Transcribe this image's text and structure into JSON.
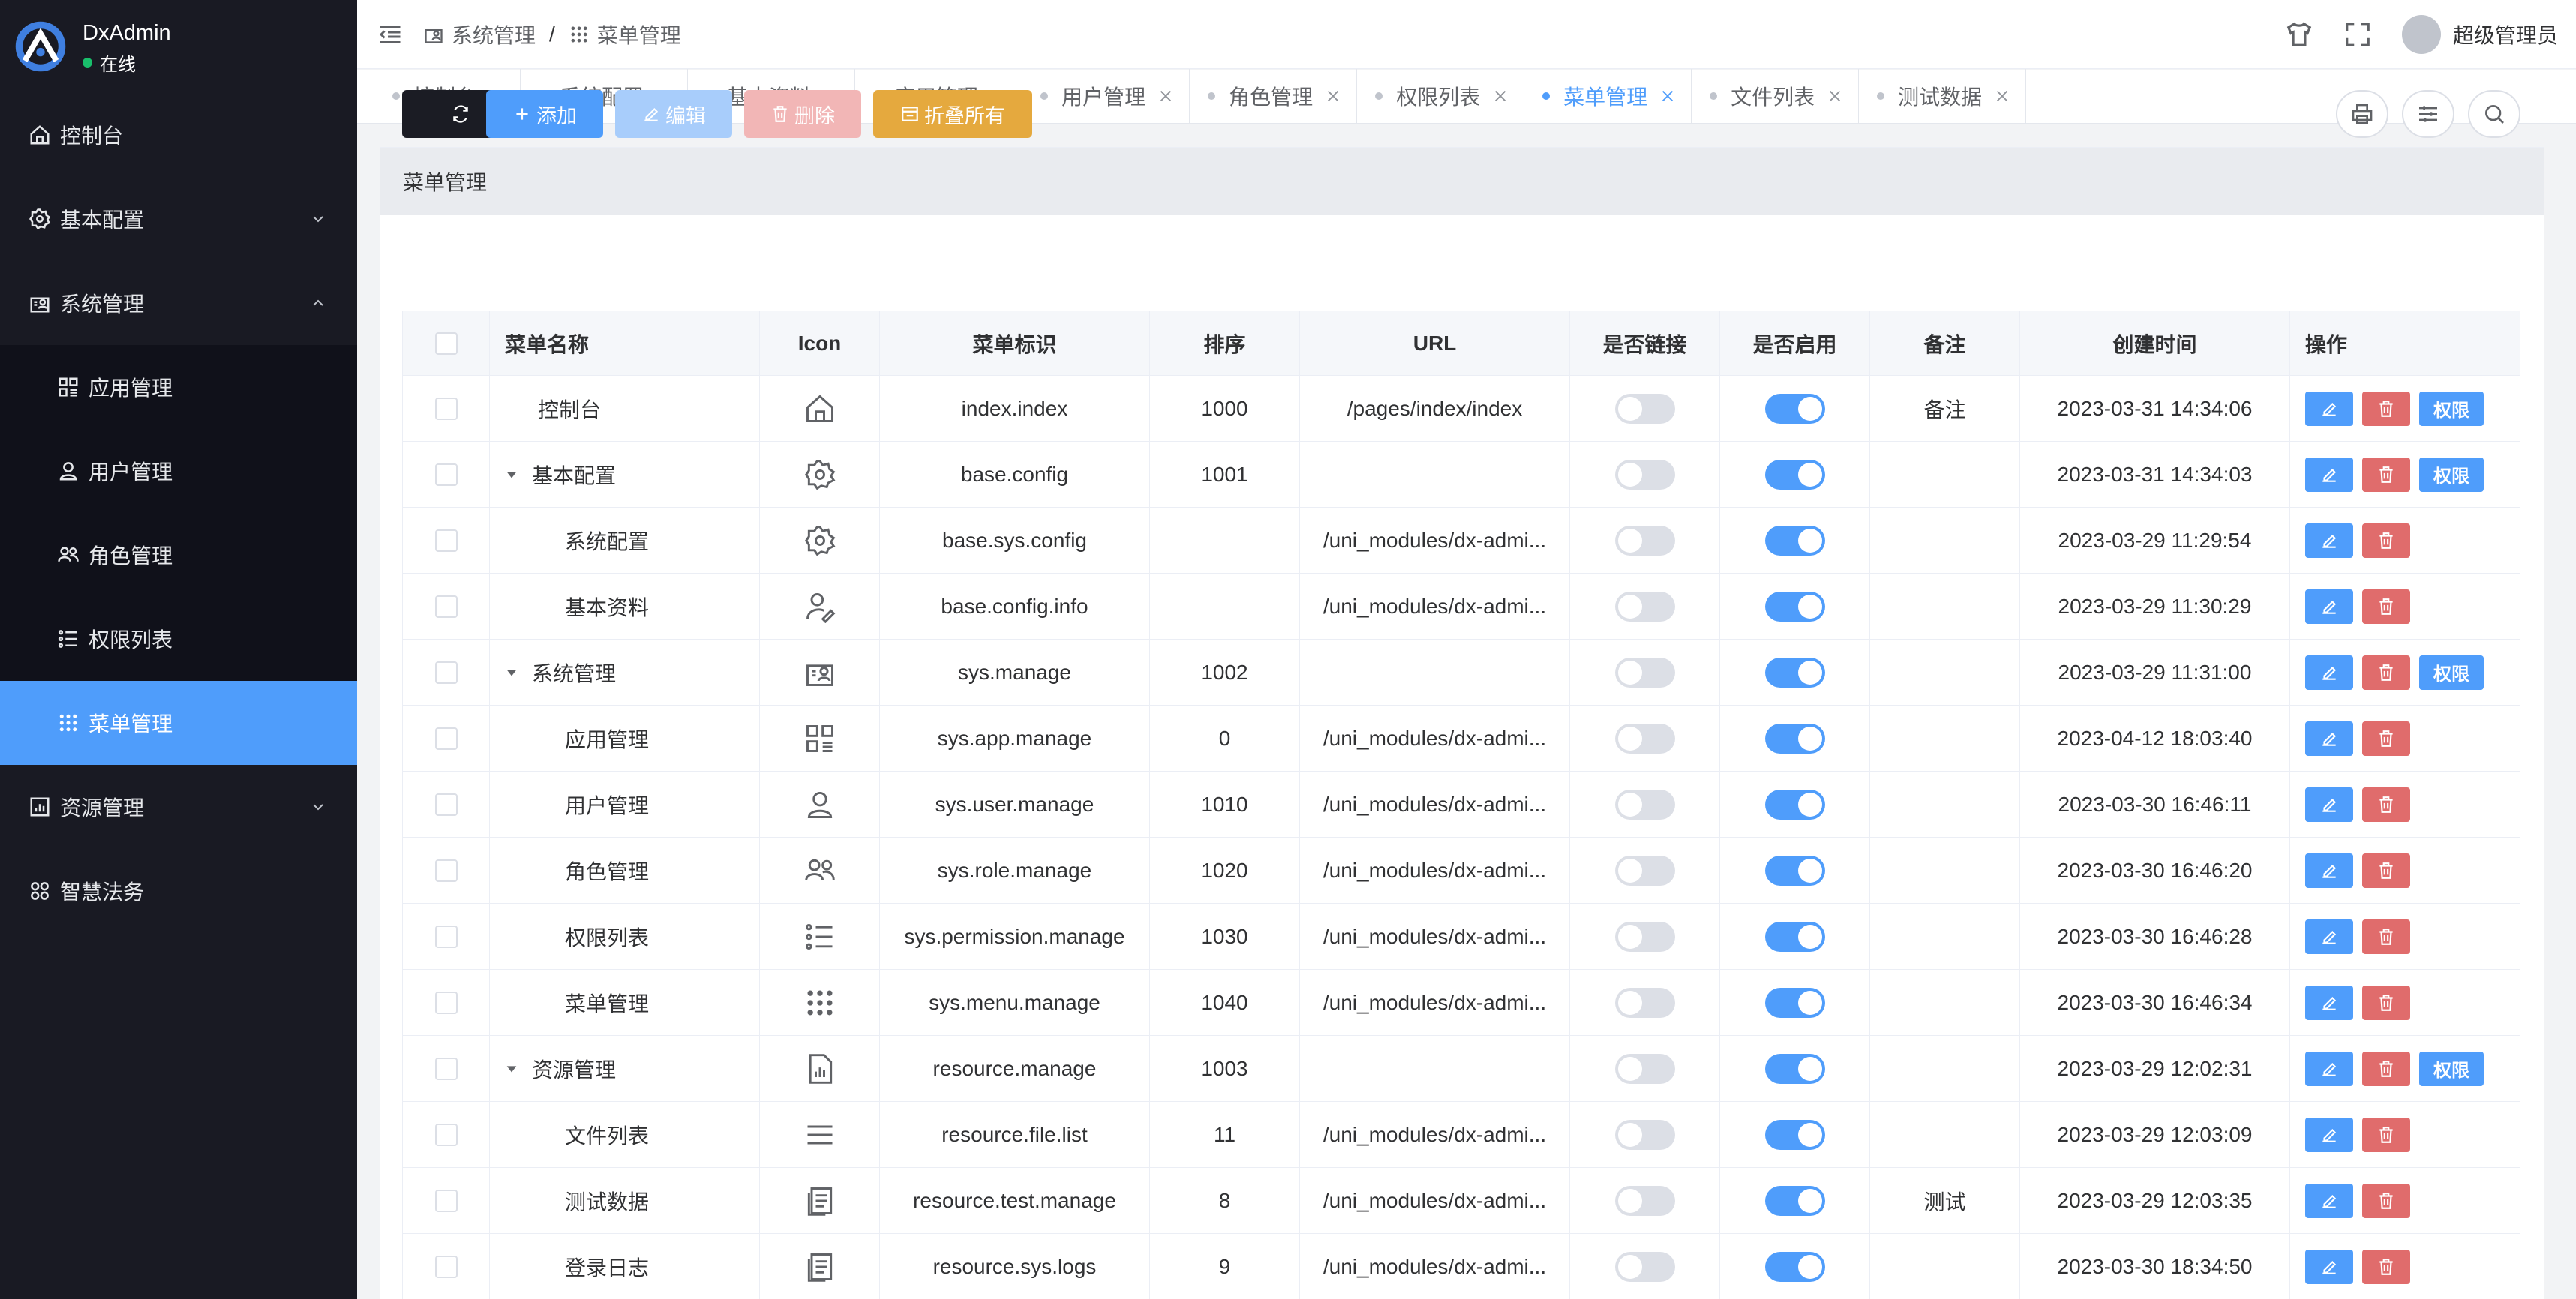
{
  "app": {
    "name": "DxAdmin",
    "status": "在线"
  },
  "sidebar": {
    "items": [
      {
        "label": "控制台",
        "icon": "home-icon"
      },
      {
        "label": "基本配置",
        "icon": "gear-icon",
        "expandable": true,
        "expanded": false
      },
      {
        "label": "系统管理",
        "icon": "admin-icon",
        "expandable": true,
        "expanded": true
      },
      {
        "label": "资源管理",
        "icon": "chart-doc-icon",
        "expandable": true,
        "expanded": false
      },
      {
        "label": "智慧法务",
        "icon": "apps-icon"
      }
    ],
    "subitems": [
      {
        "label": "应用管理",
        "icon": "grid-icon"
      },
      {
        "label": "用户管理",
        "icon": "user-icon"
      },
      {
        "label": "角色管理",
        "icon": "group-icon"
      },
      {
        "label": "权限列表",
        "icon": "list-icon"
      },
      {
        "label": "菜单管理",
        "icon": "dots-icon",
        "active": true
      }
    ]
  },
  "header": {
    "breadcrumb": [
      "系统管理",
      "菜单管理"
    ],
    "breadcrumb_sep": "/",
    "user": "超级管理员"
  },
  "tabs": [
    "控制台",
    "系统配置",
    "基本资料",
    "应用管理",
    "用户管理",
    "角色管理",
    "权限列表",
    "菜单管理",
    "文件列表",
    "测试数据"
  ],
  "active_tab": "菜单管理",
  "card": {
    "title": "菜单管理"
  },
  "toolbar": {
    "refresh_label": "",
    "add_label": "添加",
    "edit_label": "编辑",
    "delete_label": "删除",
    "collapse_label": "折叠所有"
  },
  "colors": {
    "primary": "#4f9dfb",
    "danger": "#e06c6c",
    "warning": "#e5a93e",
    "sidebar": "#191a23",
    "success": "#19be6b"
  },
  "table": {
    "columns": [
      "菜单名称",
      "Icon",
      "菜单标识",
      "排序",
      "URL",
      "是否链接",
      "是否启用",
      "备注",
      "创建时间",
      "操作"
    ],
    "actions": {
      "perm": "权限"
    },
    "rows": [
      {
        "name": "控制台",
        "level": 0,
        "expandable": false,
        "icon": "home-icon",
        "key": "index.index",
        "sort": "1000",
        "url": "/pages/index/index",
        "link": false,
        "enabled": true,
        "remark": "备注",
        "created": "2023-03-31 14:34:06",
        "perm": true
      },
      {
        "name": "基本配置",
        "level": 0,
        "expandable": true,
        "icon": "gear-icon",
        "key": "base.config",
        "sort": "1001",
        "url": "",
        "link": false,
        "enabled": true,
        "remark": "",
        "created": "2023-03-31 14:34:03",
        "perm": true
      },
      {
        "name": "系统配置",
        "level": 1,
        "expandable": false,
        "icon": "gear-icon",
        "key": "base.sys.config",
        "sort": "",
        "url": "/uni_modules/dx-admi...",
        "link": false,
        "enabled": true,
        "remark": "",
        "created": "2023-03-29 11:29:54",
        "perm": false
      },
      {
        "name": "基本资料",
        "level": 1,
        "expandable": false,
        "icon": "user-edit-icon",
        "key": "base.config.info",
        "sort": "",
        "url": "/uni_modules/dx-admi...",
        "link": false,
        "enabled": true,
        "remark": "",
        "created": "2023-03-29 11:30:29",
        "perm": false
      },
      {
        "name": "系统管理",
        "level": 0,
        "expandable": true,
        "icon": "admin-icon",
        "key": "sys.manage",
        "sort": "1002",
        "url": "",
        "link": false,
        "enabled": true,
        "remark": "",
        "created": "2023-03-29 11:31:00",
        "perm": true
      },
      {
        "name": "应用管理",
        "level": 1,
        "expandable": false,
        "icon": "grid-icon",
        "key": "sys.app.manage",
        "sort": "0",
        "url": "/uni_modules/dx-admi...",
        "link": false,
        "enabled": true,
        "remark": "",
        "created": "2023-04-12 18:03:40",
        "perm": false
      },
      {
        "name": "用户管理",
        "level": 1,
        "expandable": false,
        "icon": "user-icon",
        "key": "sys.user.manage",
        "sort": "1010",
        "url": "/uni_modules/dx-admi...",
        "link": false,
        "enabled": true,
        "remark": "",
        "created": "2023-03-30 16:46:11",
        "perm": false
      },
      {
        "name": "角色管理",
        "level": 1,
        "expandable": false,
        "icon": "group-icon",
        "key": "sys.role.manage",
        "sort": "1020",
        "url": "/uni_modules/dx-admi...",
        "link": false,
        "enabled": true,
        "remark": "",
        "created": "2023-03-30 16:46:20",
        "perm": false
      },
      {
        "name": "权限列表",
        "level": 1,
        "expandable": false,
        "icon": "list-icon",
        "key": "sys.permission.manage",
        "sort": "1030",
        "url": "/uni_modules/dx-admi...",
        "link": false,
        "enabled": true,
        "remark": "",
        "created": "2023-03-30 16:46:28",
        "perm": false
      },
      {
        "name": "菜单管理",
        "level": 1,
        "expandable": false,
        "icon": "dots-icon",
        "key": "sys.menu.manage",
        "sort": "1040",
        "url": "/uni_modules/dx-admi...",
        "link": false,
        "enabled": true,
        "remark": "",
        "created": "2023-03-30 16:46:34",
        "perm": false
      },
      {
        "name": "资源管理",
        "level": 0,
        "expandable": true,
        "icon": "chart-doc-icon",
        "key": "resource.manage",
        "sort": "1003",
        "url": "",
        "link": false,
        "enabled": true,
        "remark": "",
        "created": "2023-03-29 12:02:31",
        "perm": true
      },
      {
        "name": "文件列表",
        "level": 1,
        "expandable": false,
        "icon": "menu-lines-icon",
        "key": "resource.file.list",
        "sort": "11",
        "url": "/uni_modules/dx-admi...",
        "link": false,
        "enabled": true,
        "remark": "",
        "created": "2023-03-29 12:03:09",
        "perm": false
      },
      {
        "name": "测试数据",
        "level": 1,
        "expandable": false,
        "icon": "docs-icon",
        "key": "resource.test.manage",
        "sort": "8",
        "url": "/uni_modules/dx-admi...",
        "link": false,
        "enabled": true,
        "remark": "测试",
        "created": "2023-03-29 12:03:35",
        "perm": false
      },
      {
        "name": "登录日志",
        "level": 1,
        "expandable": false,
        "icon": "docs-icon",
        "key": "resource.sys.logs",
        "sort": "9",
        "url": "/uni_modules/dx-admi...",
        "link": false,
        "enabled": true,
        "remark": "",
        "created": "2023-03-30 18:34:50",
        "perm": false
      }
    ]
  }
}
